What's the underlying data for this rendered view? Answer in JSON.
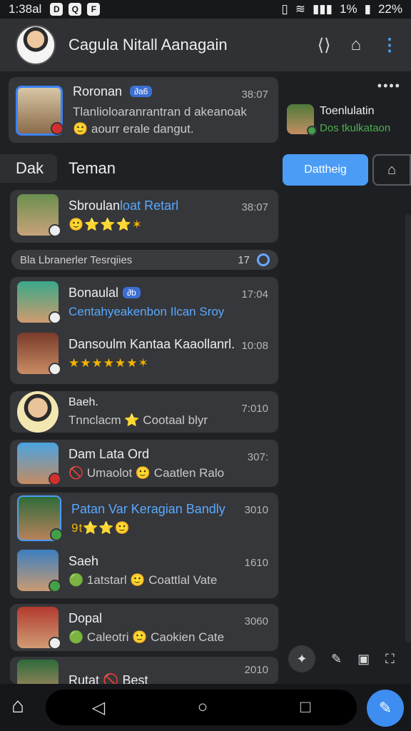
{
  "status": {
    "time": "1:38al",
    "icons": [
      "D",
      "Q",
      "F"
    ],
    "right_icons": [
      "▯",
      "≋",
      "▮▮▮"
    ],
    "battery1": "1%",
    "battery2": "22%"
  },
  "header": {
    "title": "Cagula Nitall Aanagain"
  },
  "pinned": {
    "name": "Roronan",
    "badge": "∂a6",
    "time": "38:07",
    "line1": "Tlanlioloaranrantran d akeanoak",
    "line2": "🙂 aourr erale dangut."
  },
  "section": {
    "left": "Dak",
    "title": "Teman"
  },
  "chats": [
    {
      "name": "Sbroulan",
      "name_extra": "loat Retarl",
      "sub": "🙂⭐⭐⭐✶",
      "time": "38:07"
    },
    {
      "name": "Bonaulal",
      "badge": "∂b",
      "sub": "Centahyeakenbon Ilcan Sroy",
      "time": "17:04"
    },
    {
      "name": "Dansoulm Kantaa Kaaollanrl.",
      "sub": "★★★★★★✶",
      "time": "10:08"
    },
    {
      "name": "Baeh.",
      "sub": "Tnnclacm ⭐ Cootaal blyr",
      "time": "7:010"
    },
    {
      "name": "Dam Lata Ord",
      "sub": "🚫 Umaolot 🙂 Caatlen Ralo",
      "time": "307:"
    },
    {
      "name": "Patan Var Keragian Bandly",
      "sub": "9t⭐⭐🙂",
      "time": "3010"
    },
    {
      "name": "Saeh",
      "sub": "🟢 1atstarl 🙂 Coattlal Vate",
      "time": "1610"
    },
    {
      "name": "Dopal",
      "sub": "🟢 Caleotri 🙂 Caokien Cate",
      "time": "3060"
    },
    {
      "name": "Rutat",
      "name_extra": "🚫 Best",
      "sub": "",
      "time": "2010"
    }
  ],
  "divider": {
    "label": "Bla Lbranerler Tesrqiies",
    "count": "17"
  },
  "side": {
    "name": "Toenlulatin",
    "sub": "Dos tkulkataon",
    "button": "Dattheig"
  },
  "nav": {
    "back": "◁",
    "home": "○",
    "recent": "□"
  },
  "colors": {
    "accent": "#4a9cf5",
    "green": "#4caf50",
    "link": "#59a9ff"
  }
}
